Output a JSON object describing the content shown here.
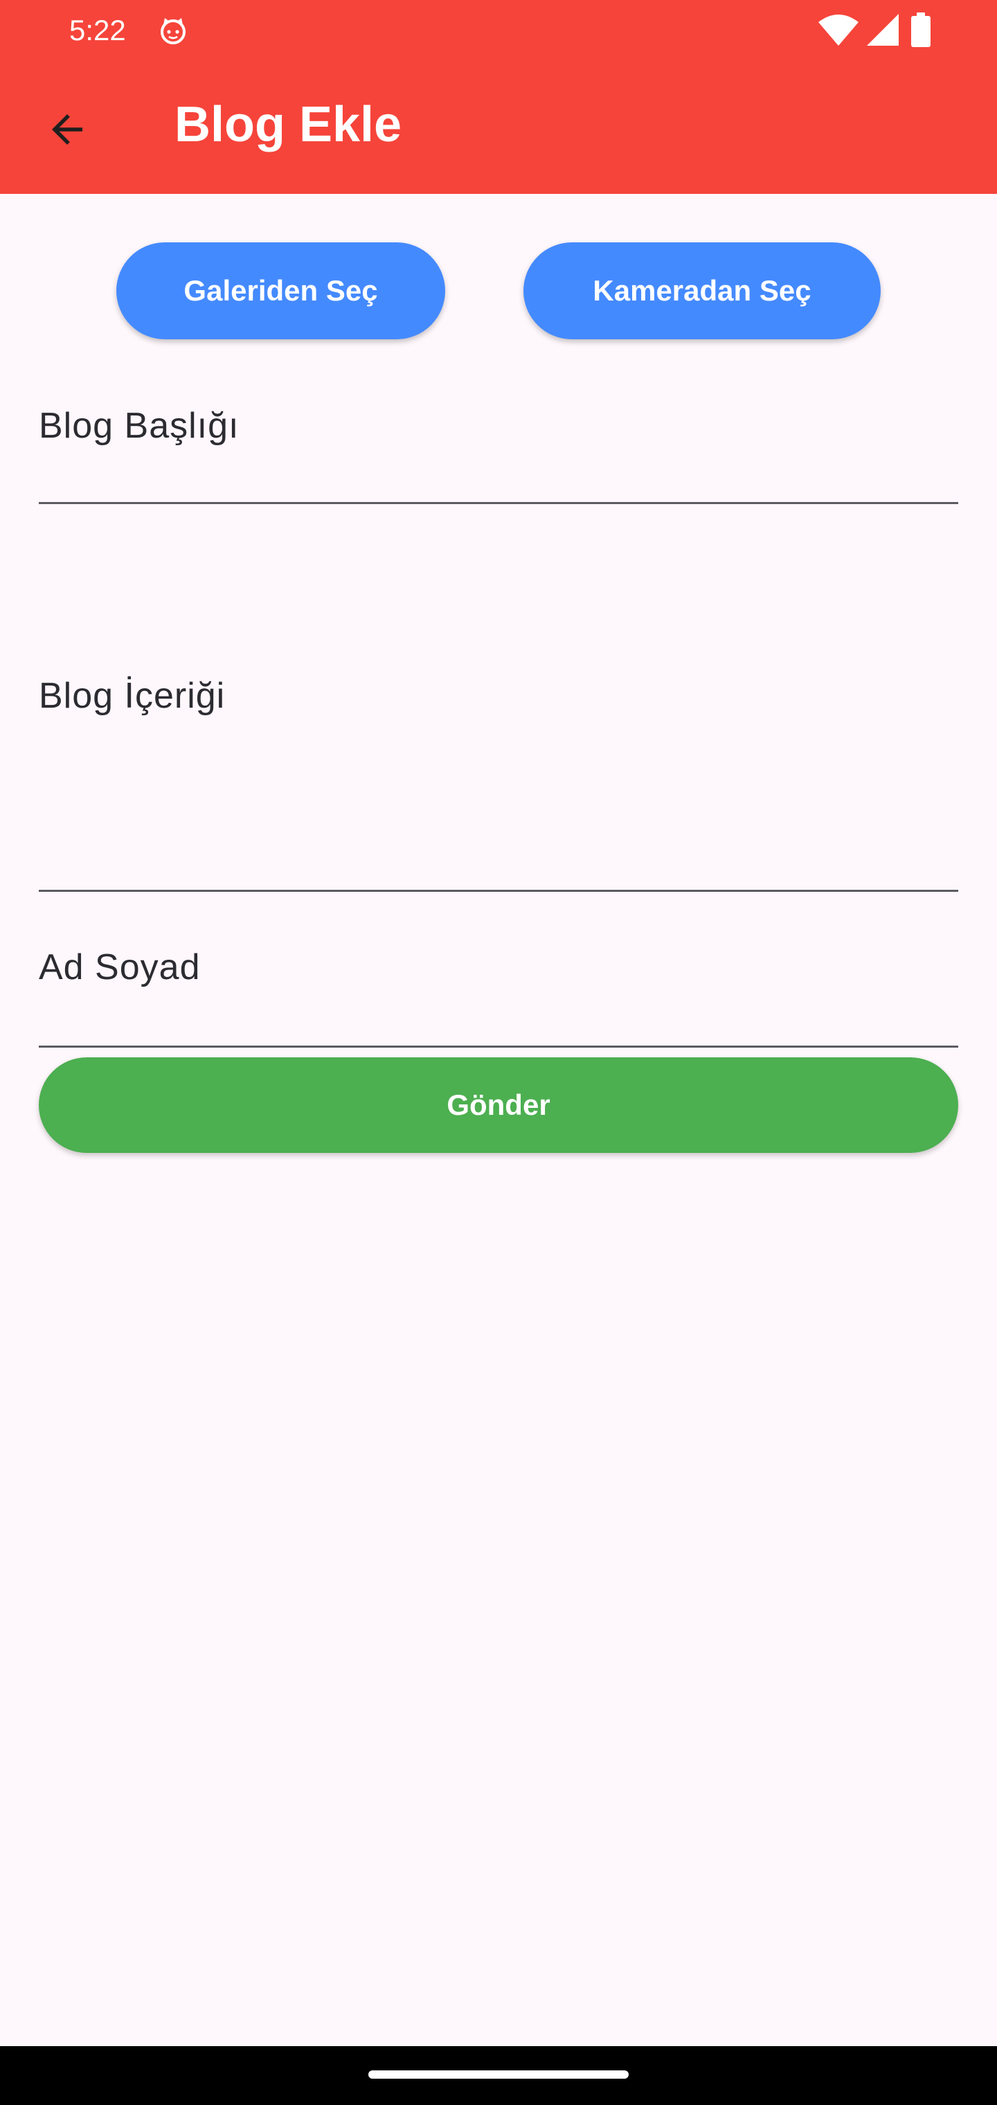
{
  "status_bar": {
    "time": "5:22",
    "app_icon": "cat-face-icon",
    "wifi_icon": "wifi-icon",
    "signal_icon": "signal-icon",
    "battery_icon": "battery-icon"
  },
  "header": {
    "back_icon": "arrow-back-icon",
    "title": "Blog Ekle",
    "background_color": "#f6443a"
  },
  "image_buttons": {
    "gallery_label": "Galeriden Seç",
    "camera_label": "Kameradan Seç",
    "color": "#448aff"
  },
  "form": {
    "title_label": "Blog Başlığı",
    "content_label": "Blog İçeriği",
    "author_label": "Ad Soyad"
  },
  "submit": {
    "label": "Gönder",
    "color": "#4caf50"
  },
  "nav_bar": {
    "home_handle": "home-indicator"
  }
}
